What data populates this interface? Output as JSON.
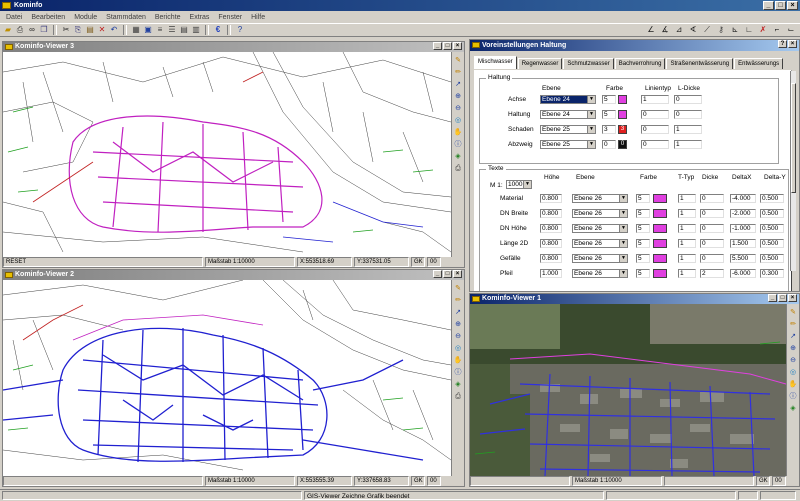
{
  "app": {
    "title": "Kominfo"
  },
  "menu": [
    "Datei",
    "Bearbeiten",
    "Module",
    "Stammdaten",
    "Berichte",
    "Extras",
    "Fenster",
    "Hilfe"
  ],
  "viewer3": {
    "title": "Kominfo-Viewer 3",
    "status": {
      "mode": "RESET",
      "scale": "Maßstab  1:10000",
      "x": "X:553518.69",
      "y": "Y:337531.05",
      "gk": "GK",
      "gk_val": "00"
    }
  },
  "viewer2": {
    "title": "Kominfo-Viewer 2",
    "status": {
      "scale": "Maßstab  1:10000",
      "x": "X:553555.39",
      "y": "Y:337658.83",
      "gk": "GK",
      "gk_val": "00"
    }
  },
  "viewer1": {
    "title": "Kominfo-Viewer 1",
    "status": {
      "scale": "Maßstab  1:10000",
      "gk": "GK",
      "gk_val": "00"
    }
  },
  "dialog": {
    "title": "Voreinstellungen Haltung",
    "tabs": [
      "Mischwasser",
      "Regenwasser",
      "Schmutzwasser",
      "Bachverrohrung",
      "Straßenentwässerung",
      "Entwässerungs"
    ],
    "haltung": {
      "title": "Haltung",
      "headers": {
        "ebene": "Ebene",
        "farbe": "Farbe",
        "linientyp": "Linientyp",
        "ldicke": "L-Dicke"
      },
      "rows": [
        {
          "label": "Achse",
          "ebene": "Ebene 24",
          "farbe": "5",
          "color": "#e040e0",
          "swatch": "",
          "linientyp": "1",
          "ldicke": "0",
          "selected": true
        },
        {
          "label": "Haltung",
          "ebene": "Ebene 24",
          "farbe": "5",
          "color": "#e040e0",
          "swatch": "",
          "linientyp": "0",
          "ldicke": "0",
          "selected": false
        },
        {
          "label": "Schaden",
          "ebene": "Ebene 25",
          "farbe": "3",
          "color": "#e02020",
          "swatch": "3",
          "linientyp": "0",
          "ldicke": "1",
          "selected": false
        },
        {
          "label": "Abzweig",
          "ebene": "Ebene 25",
          "farbe": "0",
          "color": "#101010",
          "swatch": "0",
          "linientyp": "0",
          "ldicke": "1",
          "selected": false
        }
      ]
    },
    "texte": {
      "title": "Texte",
      "scale_label": "M 1:",
      "scale_value": "1000",
      "headers": {
        "hoehe": "Höhe",
        "ebene": "Ebene",
        "farbe": "Farbe",
        "ttyp": "T-Typ",
        "dicke": "Dicke",
        "deltax": "DeltaX",
        "deltay": "Delta-Y"
      },
      "rows": [
        {
          "label": "Material",
          "hoehe": "0.800",
          "ebene": "Ebene 26",
          "farbe": "5",
          "ttyp": "1",
          "dicke": "0",
          "deltax": "-4.000",
          "deltay": "0.500"
        },
        {
          "label": "DN Breite",
          "hoehe": "0.800",
          "ebene": "Ebene 26",
          "farbe": "5",
          "ttyp": "1",
          "dicke": "0",
          "deltax": "-2.000",
          "deltay": "0.500"
        },
        {
          "label": "DN Höhe",
          "hoehe": "0.800",
          "ebene": "Ebene 26",
          "farbe": "5",
          "ttyp": "1",
          "dicke": "0",
          "deltax": "-1.000",
          "deltay": "0.500"
        },
        {
          "label": "Länge 2D",
          "hoehe": "0.800",
          "ebene": "Ebene 26",
          "farbe": "5",
          "ttyp": "1",
          "dicke": "0",
          "deltax": "1.500",
          "deltay": "0.500"
        },
        {
          "label": "Gefälle",
          "hoehe": "0.800",
          "ebene": "Ebene 26",
          "farbe": "5",
          "ttyp": "1",
          "dicke": "0",
          "deltax": "5.500",
          "deltay": "0.500"
        },
        {
          "label": "Pfeil",
          "hoehe": "1.000",
          "ebene": "Ebene 26",
          "farbe": "5",
          "ttyp": "1",
          "dicke": "2",
          "deltax": "-6.000",
          "deltay": "0.300"
        }
      ]
    }
  },
  "statusbar": {
    "message": "GIS-Viewer Zeichne Grafik beendet"
  },
  "colors": {
    "titlebar": "#0a246a",
    "magenta": "#e040e0",
    "network_v3": "#c020c0",
    "network_v2": "#2020d0",
    "aerial_bg": "#4a5a3a"
  }
}
